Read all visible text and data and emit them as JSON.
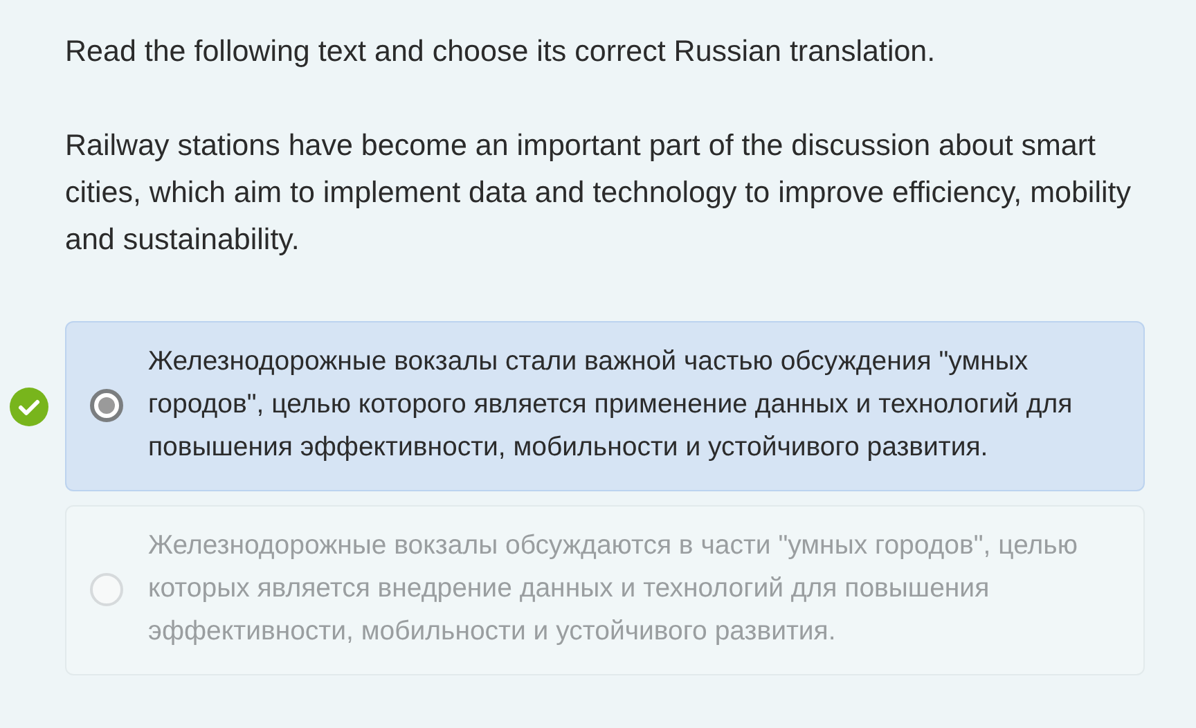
{
  "question": {
    "instruction": "Read the following text and choose its correct Russian translation.",
    "passage": "Railway stations have become an important part of the discussion about smart cities, which aim to implement data and technology to improve efficiency, mobility and sustainability."
  },
  "options": [
    {
      "text": "Железнодорожные вокзалы стали важной частью обсуждения \"умных городов\", целью которого является применение данных и технологий для повышения эффективности, мобильности и устойчивого развития.",
      "selected": true,
      "correct": true,
      "disabled": false
    },
    {
      "text": "Железнодорожные вокзалы обсуждаются в части \"умных городов\", целью которых является внедрение данных и технологий для повышения эффективности, мобильности и устойчивого развития.",
      "selected": false,
      "correct": false,
      "disabled": true
    }
  ]
}
